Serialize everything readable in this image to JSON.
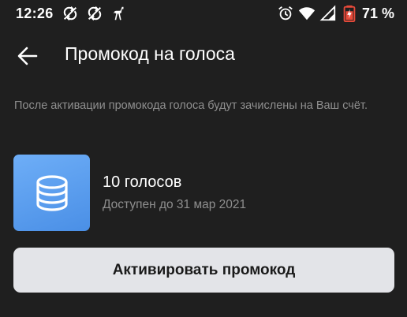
{
  "status_bar": {
    "time": "12:26",
    "left_icons": [
      "sync-off-icon",
      "sync-off-icon",
      "ostrich-icon"
    ],
    "right_icons": [
      "alarm-icon",
      "wifi-icon",
      "signal-icon",
      "battery-charging-icon"
    ],
    "battery_percent": "71 %"
  },
  "header": {
    "back_icon": "arrow-left-icon",
    "title": "Промокод на голоса"
  },
  "description": "После активации промокода голоса будут зачислены на Ваш счёт.",
  "promo": {
    "icon": "coins-stack-icon",
    "title": "10 голосов",
    "subtitle": "Доступен до 31 мар 2021"
  },
  "actions": {
    "activate_label": "Активировать промокод"
  },
  "colors": {
    "background": "#1f1f1f",
    "secondary_text": "#8f8f8f",
    "icon_tile": "#5a9cee",
    "button_bg": "#e3e4e8",
    "battery_accent": "#e84a3a"
  }
}
